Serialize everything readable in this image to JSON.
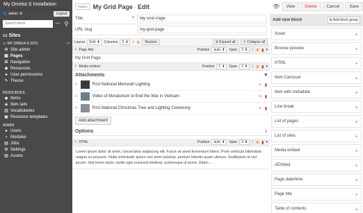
{
  "sidebar": {
    "title": "My Omeka S Installation",
    "user": "admin",
    "logout": "Logout",
    "search_placeholder": "Search items",
    "sites_label": "Sites",
    "site_name": "MY OMEKA S SITE",
    "site_items": [
      {
        "label": "Site admin",
        "icon": "gears-icon",
        "active": false
      },
      {
        "label": "Pages",
        "icon": "file-icon",
        "active": true
      },
      {
        "label": "Navigation",
        "icon": "sitemap-icon",
        "active": false
      },
      {
        "label": "Resources",
        "icon": "cubes-icon",
        "active": false
      },
      {
        "label": "User permissions",
        "icon": "users-icon",
        "active": false
      },
      {
        "label": "Theme",
        "icon": "brush-icon",
        "active": false
      }
    ],
    "resources_label": "RESOURCES",
    "resources": [
      {
        "label": "Items",
        "icon": "cube-icon"
      },
      {
        "label": "Item sets",
        "icon": "cubes-icon"
      },
      {
        "label": "Vocabularies",
        "icon": "book-icon"
      },
      {
        "label": "Resource templates",
        "icon": "template-icon"
      }
    ],
    "admin_label": "ADMIN",
    "admin": [
      {
        "label": "Users",
        "icon": "user-icon"
      },
      {
        "label": "Modules",
        "icon": "puzzle-icon"
      },
      {
        "label": "Jobs",
        "icon": "jobs-icon"
      },
      {
        "label": "Settings",
        "icon": "gears-icon"
      },
      {
        "label": "Assets",
        "icon": "image-icon"
      }
    ]
  },
  "header": {
    "resource_tag": "PAGES",
    "title": "My Grid Page",
    "sep": "·",
    "mode": "Edit"
  },
  "form": {
    "title_label": "Title",
    "title_value": "My Grid Page",
    "slug_label": "URL slug",
    "slug_value": "my-grid-page"
  },
  "layout_bar": {
    "layout_label": "Layout",
    "layout_value": "Grid",
    "columns_label": "Columns",
    "columns_value": "3",
    "restore": "Restore",
    "expand_all": "Expand all",
    "collapse_all": "Collapse all"
  },
  "blocks": [
    {
      "name": "Page title",
      "position_label": "Position",
      "position": "auto",
      "span_label": "Span",
      "span": "3",
      "body": "My Grid Page"
    },
    {
      "name": "Media embed",
      "position_label": "Position",
      "position": "1",
      "span_label": "Span",
      "span": "2"
    }
  ],
  "attachments_label": "Attachments",
  "attachments": [
    {
      "title": "First National Menorah Lighting"
    },
    {
      "title": "Video of Moratorium to End the War in Vietnam"
    },
    {
      "title": "First National Christmas Tree and Lighting Ceremony"
    }
  ],
  "add_attachment": "Add attachment",
  "options_label": "Options",
  "html_block": {
    "name": "HTML",
    "position_label": "Position",
    "position": "auto",
    "span_label": "Span",
    "span": "3",
    "text": "Lorem ipsum dolor sit amet, consectetur adipiscing elit. Fusce sit amet fermentum libero. Proin vehicula bibendum magna eu posuere. Nulla sollicitudin ipsum non enim pulvinar, pretium lobortis quam ultrices. Vestibulum at nisl ipsum. Sed lorem dolor, mollis eget euismod eleifend, scelerisque ut lorem. Etiam ..."
  },
  "toolbar": {
    "view": "View",
    "delete": "Delete",
    "cancel": "Cancel",
    "save": "Save"
  },
  "add_block": {
    "title": "Add new block",
    "group_btn": "Add block group",
    "items": [
      "Asset",
      "Browse preview",
      "HTML",
      "Item Carousel",
      "Item with metadata",
      "Line break",
      "List of pages",
      "List of sites",
      "Media embed",
      "oEmbed",
      "Page date/time",
      "Page title",
      "Table of contents"
    ]
  }
}
